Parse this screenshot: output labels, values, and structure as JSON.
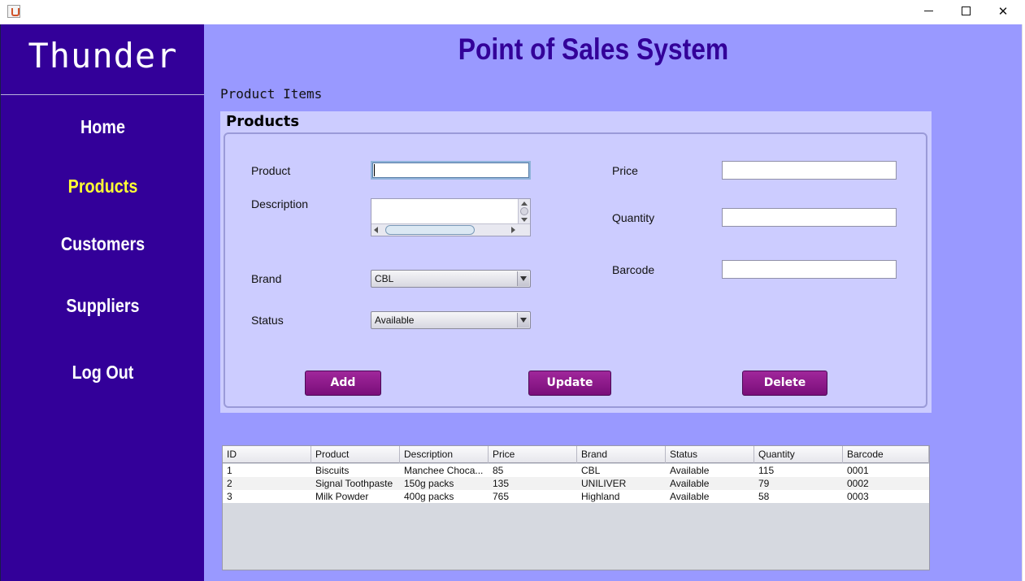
{
  "window": {
    "icon": "java-cup-icon",
    "controls": {
      "minimize": "minimize-icon",
      "maximize": "maximize-icon",
      "close": "✕"
    }
  },
  "sidebar": {
    "brand": "Thunder",
    "items": [
      {
        "label": "Home"
      },
      {
        "label": "Products",
        "active": true
      },
      {
        "label": "Customers"
      },
      {
        "label": "Suppliers"
      },
      {
        "label": "Log Out"
      }
    ]
  },
  "header": {
    "title": "Point of Sales System",
    "section": "Product Items"
  },
  "form": {
    "title": "Products",
    "product": {
      "label": "Product",
      "value": ""
    },
    "description": {
      "label": "Description",
      "value": ""
    },
    "brand": {
      "label": "Brand",
      "selected": "CBL"
    },
    "status": {
      "label": "Status",
      "selected": "Available"
    },
    "price": {
      "label": "Price",
      "value": ""
    },
    "quantity": {
      "label": "Quantity",
      "value": ""
    },
    "barcode": {
      "label": "Barcode",
      "value": ""
    },
    "buttons": {
      "add": "Add",
      "update": "Update",
      "delete": "Delete"
    }
  },
  "table": {
    "columns": [
      "ID",
      "Product",
      "Description",
      "Price",
      "Brand",
      "Status",
      "Quantity",
      "Barcode"
    ],
    "rows": [
      [
        "1",
        "Biscuits",
        "Manchee Choca...",
        "85",
        "CBL",
        "Available",
        "115",
        "0001"
      ],
      [
        "2",
        "Signal Toothpaste",
        "150g packs",
        "135",
        "UNILIVER",
        "Available",
        "79",
        "0002"
      ],
      [
        "3",
        "Milk Powder",
        "400g packs",
        "765",
        "Highland",
        "Available",
        "58",
        "0003"
      ]
    ]
  },
  "colors": {
    "sidebar": "#330099",
    "main_bg": "#9999ff",
    "panel_bg": "#ccccff",
    "active_nav": "#ffff33",
    "button": "#8b1a8b",
    "title": "#330099"
  }
}
